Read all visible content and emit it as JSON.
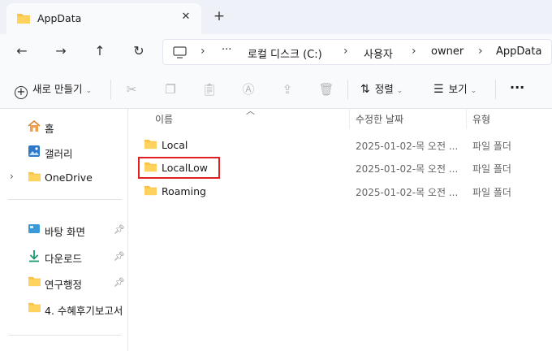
{
  "tab": {
    "title": "AppData",
    "close": "✕",
    "new_tab": "+"
  },
  "nav": {
    "back": "←",
    "forward": "→",
    "up": "↑",
    "refresh": "↻"
  },
  "address": {
    "crumbs": [
      "로컬 디스크 (C:)",
      "사용자",
      "owner",
      "AppData"
    ],
    "ellipsis": "···",
    "separator": "›"
  },
  "toolbar": {
    "new_label": "새로 만들기",
    "sort_label": "정렬",
    "view_label": "보기",
    "more": "···"
  },
  "sidebar": {
    "items": [
      {
        "label": "홈",
        "icon": "home-icon"
      },
      {
        "label": "갤러리",
        "icon": "gallery-icon"
      },
      {
        "label": "OneDrive",
        "icon": "folder-icon"
      },
      {
        "label": "바탕 화면",
        "icon": "desktop-icon"
      },
      {
        "label": "다운로드",
        "icon": "download-icon"
      },
      {
        "label": "연구행정",
        "icon": "folder-icon"
      },
      {
        "label": "4. 수혜후기보고서",
        "icon": "folder-icon"
      }
    ]
  },
  "columns": {
    "name": "이름",
    "date": "수정한 날짜",
    "type": "유형"
  },
  "files": [
    {
      "name": "Local",
      "date": "2025-01-02-목 오전 ...",
      "type": "파일 폴더"
    },
    {
      "name": "LocalLow",
      "date": "2025-01-02-목 오전 ...",
      "type": "파일 폴더"
    },
    {
      "name": "Roaming",
      "date": "2025-01-02-목 오전 ...",
      "type": "파일 폴더"
    }
  ],
  "colors": {
    "folder": "#f7c344",
    "highlight": "#e02020",
    "accent": "#0067c0"
  }
}
